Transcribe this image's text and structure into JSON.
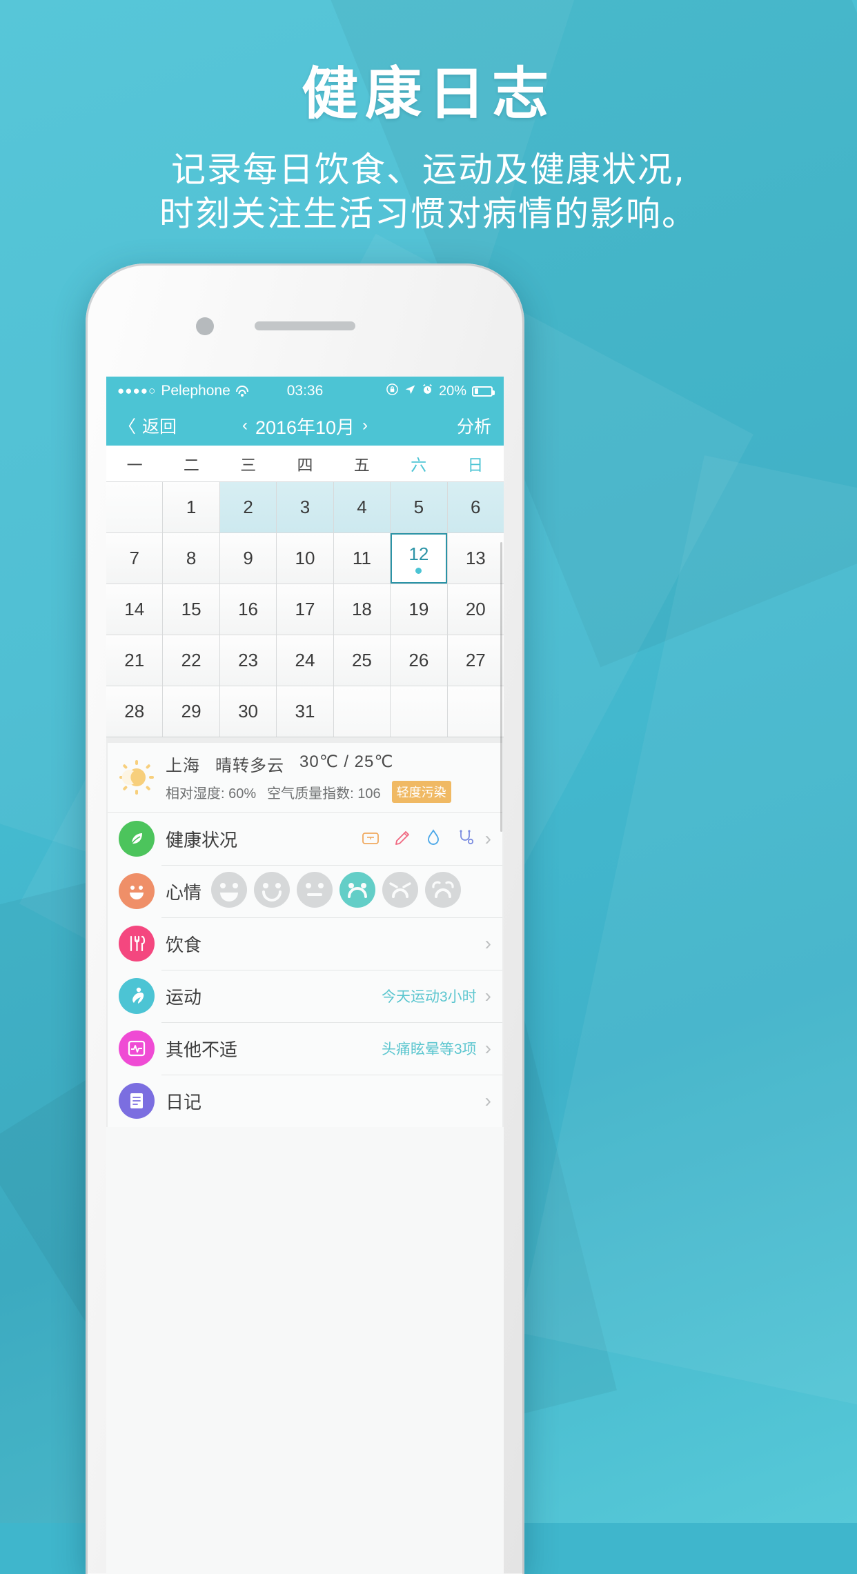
{
  "hero": {
    "title": "健康日志",
    "subtitle_line1": "记录每日饮食、运动及健康状况,",
    "subtitle_line2": "时刻关注生活习惯对病情的影响。"
  },
  "statusbar": {
    "signal_dots": "●●●●○",
    "carrier": "Pelephone",
    "wifi_icon": "wifi-icon",
    "time": "03:36",
    "lock_icon": "rotation-lock-icon",
    "location_icon": "location-arrow-icon",
    "alarm_icon": "alarm-clock-icon",
    "battery_percent": "20%",
    "battery_icon": "battery-icon"
  },
  "navbar": {
    "back_label": "返回",
    "back_icon": "chevron-left-icon",
    "prev_month_icon": "‹",
    "title": "2016年10月",
    "next_month_icon": "›",
    "right_label": "分析"
  },
  "calendar": {
    "weekday_headers": [
      "一",
      "二",
      "三",
      "四",
      "五",
      "六",
      "日"
    ],
    "weekend_indices": [
      5,
      6
    ],
    "rows": [
      [
        {
          "day": "",
          "state": "empty"
        },
        {
          "day": "1",
          "state": "normal"
        },
        {
          "day": "2",
          "state": "highlight"
        },
        {
          "day": "3",
          "state": "highlight"
        },
        {
          "day": "4",
          "state": "highlight"
        },
        {
          "day": "5",
          "state": "highlight"
        },
        {
          "day": "6",
          "state": "highlight"
        }
      ],
      [
        {
          "day": "7",
          "state": "normal"
        },
        {
          "day": "8",
          "state": "normal"
        },
        {
          "day": "9",
          "state": "normal"
        },
        {
          "day": "10",
          "state": "normal"
        },
        {
          "day": "11",
          "state": "normal"
        },
        {
          "day": "12",
          "state": "selected",
          "dot": true
        },
        {
          "day": "13",
          "state": "normal"
        }
      ],
      [
        {
          "day": "14",
          "state": "normal"
        },
        {
          "day": "15",
          "state": "normal"
        },
        {
          "day": "16",
          "state": "normal"
        },
        {
          "day": "17",
          "state": "normal"
        },
        {
          "day": "18",
          "state": "normal"
        },
        {
          "day": "19",
          "state": "normal"
        },
        {
          "day": "20",
          "state": "normal"
        }
      ],
      [
        {
          "day": "21",
          "state": "normal"
        },
        {
          "day": "22",
          "state": "normal"
        },
        {
          "day": "23",
          "state": "normal"
        },
        {
          "day": "24",
          "state": "normal"
        },
        {
          "day": "25",
          "state": "normal"
        },
        {
          "day": "26",
          "state": "normal"
        },
        {
          "day": "27",
          "state": "normal"
        }
      ],
      [
        {
          "day": "28",
          "state": "normal"
        },
        {
          "day": "29",
          "state": "normal"
        },
        {
          "day": "30",
          "state": "normal"
        },
        {
          "day": "31",
          "state": "normal"
        },
        {
          "day": "",
          "state": "empty"
        },
        {
          "day": "",
          "state": "empty"
        },
        {
          "day": "",
          "state": "empty"
        }
      ]
    ]
  },
  "weather": {
    "icon": "sun-moon-icon",
    "city": "上海",
    "condition": "晴转多云",
    "temperature": "30℃ / 25℃",
    "humidity_label": "相对湿度: 60%",
    "aqi_label": "空气质量指数: 106",
    "aqi_badge": "轻度污染",
    "aqi_badge_color": "#f0b963"
  },
  "list": {
    "items": [
      {
        "label": "健康状况",
        "icon": "leaf-icon",
        "icon_color": "#4cc45c",
        "value": "",
        "inline_icons": [
          "weight-scale-icon",
          "thermometer-icon",
          "blood-drop-icon",
          "stethoscope-icon"
        ],
        "chevron": "›"
      },
      {
        "label": "心情",
        "icon": "smiley-face-icon",
        "icon_color": "#ef8f68",
        "moods": [
          {
            "name": "laugh-face",
            "selected": false
          },
          {
            "name": "smile-face",
            "selected": false
          },
          {
            "name": "neutral-face",
            "selected": false
          },
          {
            "name": "sad-face",
            "selected": true
          },
          {
            "name": "upset-face",
            "selected": false
          },
          {
            "name": "crying-face",
            "selected": false
          }
        ],
        "chevron": ""
      },
      {
        "label": "饮食",
        "icon": "cutlery-icon",
        "icon_color": "#f4477f",
        "value": "",
        "chevron": "›"
      },
      {
        "label": "运动",
        "icon": "running-person-icon",
        "icon_color": "#4cc4d4",
        "value": "今天运动3小时",
        "chevron": "›"
      },
      {
        "label": "其他不适",
        "icon": "heartbeat-icon",
        "icon_color": "#ef4bd4",
        "value": "头痛眩晕等3项",
        "chevron": "›"
      },
      {
        "label": "日记",
        "icon": "notebook-icon",
        "icon_color": "#7b6ee0",
        "value": "",
        "chevron": "›"
      }
    ]
  },
  "colors": {
    "brand": "#4cc4d4",
    "background": "#46bcd1",
    "selected_day_border": "#2b93a6",
    "highlight_cell": "#d3ebf1"
  }
}
